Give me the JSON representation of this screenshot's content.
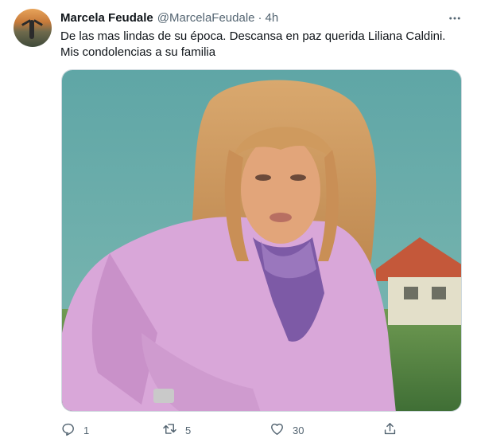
{
  "tweet": {
    "author_name": "Marcela Feudale",
    "author_handle": "@MarcelaFeudale",
    "separator": "·",
    "time": "4h",
    "text_lines": [
      "De las mas lindas de su época. Descansa en paz querida Liliana Caldini.",
      "Mis condolencias a su familia"
    ]
  },
  "actions": {
    "reply_count": "1",
    "retweet_count": "5",
    "like_count": "30"
  },
  "icons": {
    "more": "more-icon",
    "reply": "reply-icon",
    "retweet": "retweet-icon",
    "like": "like-icon",
    "share": "share-icon"
  },
  "colors": {
    "secondary_text": "#536471",
    "primary_text": "#0f1419"
  }
}
